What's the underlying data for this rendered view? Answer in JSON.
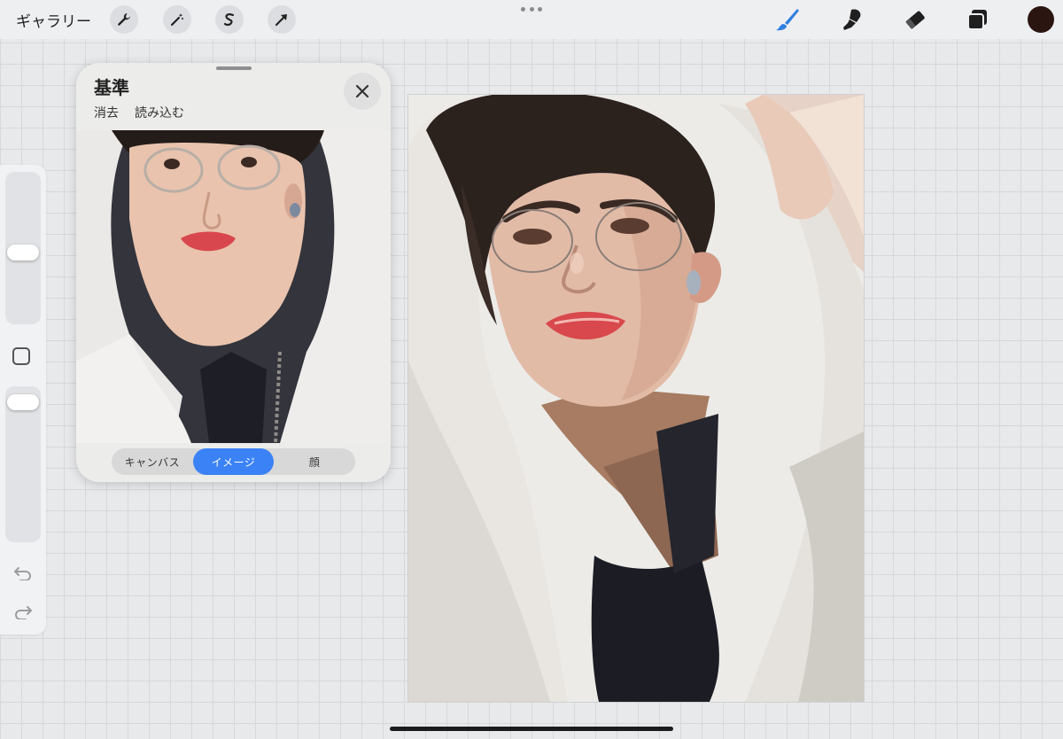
{
  "topbar": {
    "gallery_label": "ギャラリー",
    "left_tools": [
      "wrench-icon",
      "magic-wand-icon",
      "selection-icon",
      "transform-arrow-icon"
    ],
    "right_tools": [
      "brush-icon",
      "smudge-icon",
      "eraser-icon",
      "layers-icon"
    ],
    "active_tool": "brush-icon",
    "color": "#2a1510",
    "accent": "#3b82f6"
  },
  "sidebar": {
    "brush_size_level": 0.52,
    "opacity_level": 0.94,
    "icons": [
      "modify-square-icon",
      "undo-icon",
      "redo-icon"
    ]
  },
  "reference": {
    "title": "基準",
    "clear_label": "消去",
    "import_label": "読み込む",
    "tabs": [
      {
        "label": "キャンバス",
        "active": false
      },
      {
        "label": "イメージ",
        "active": true
      },
      {
        "label": "顔",
        "active": false
      }
    ]
  }
}
